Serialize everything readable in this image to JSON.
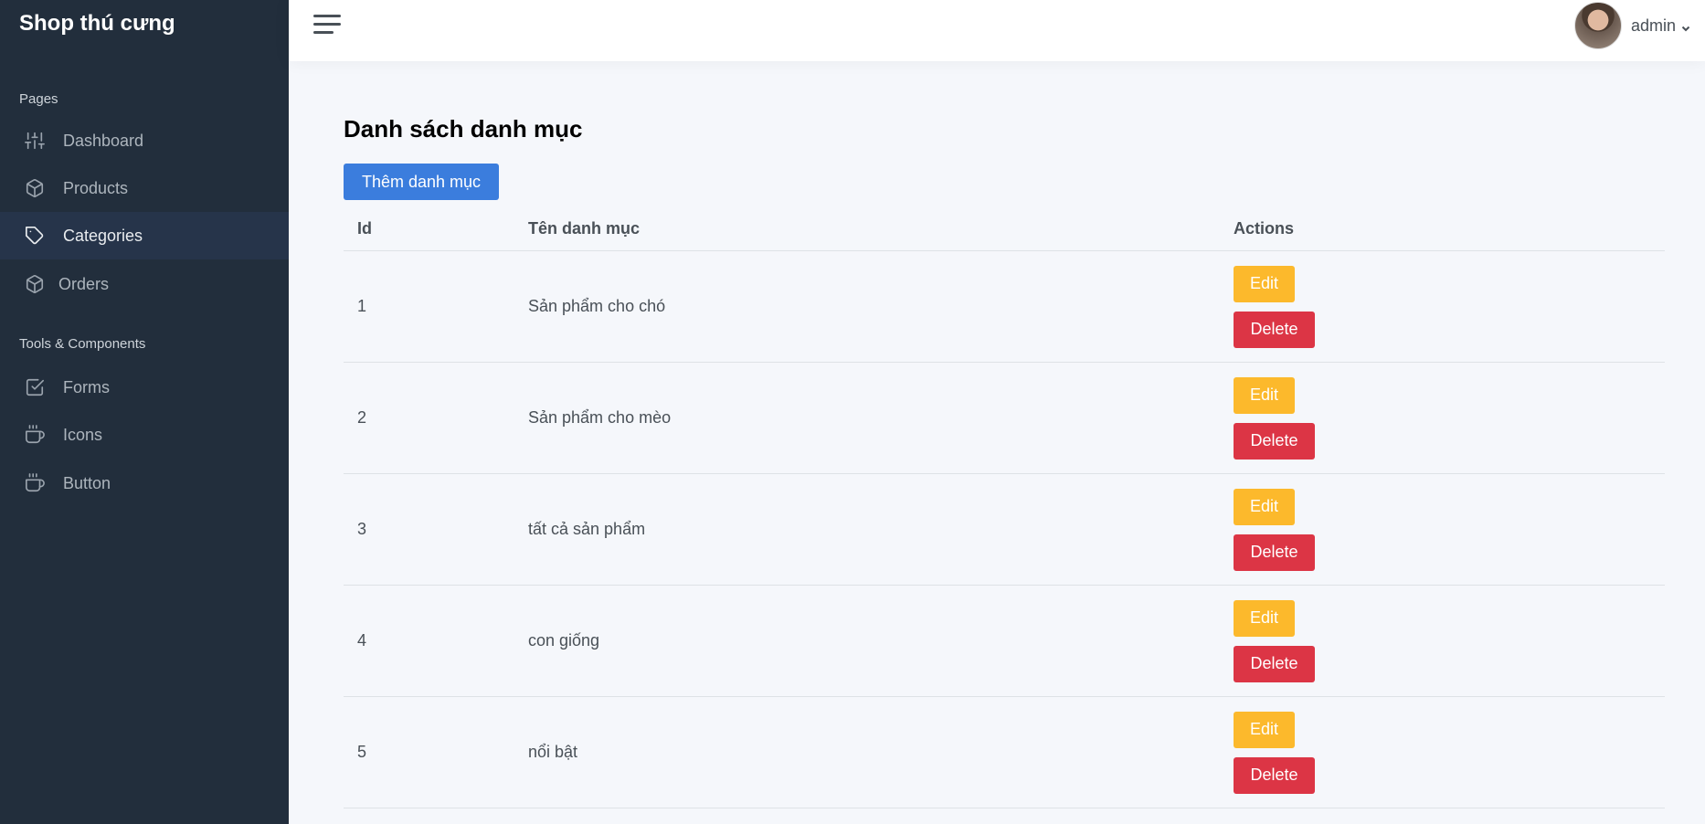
{
  "sidebar": {
    "brand": "Shop thú cưng",
    "sections": [
      {
        "header": "Pages",
        "items": [
          {
            "label": "Dashboard",
            "icon": "sliders-icon",
            "active": false
          },
          {
            "label": "Products",
            "icon": "box-icon",
            "active": false
          },
          {
            "label": "Categories",
            "icon": "tag-icon",
            "active": true
          },
          {
            "label": "Orders",
            "icon": "box-icon",
            "active": false
          }
        ]
      },
      {
        "header": "Tools & Components",
        "items": [
          {
            "label": "Forms",
            "icon": "check-square-icon",
            "active": false
          },
          {
            "label": "Icons",
            "icon": "coffee-icon",
            "active": false
          },
          {
            "label": "Button",
            "icon": "coffee-icon",
            "active": false
          }
        ]
      }
    ]
  },
  "topbar": {
    "menu_icon": "hamburger-icon",
    "user_name": "admin"
  },
  "main": {
    "title": "Danh sách danh mục",
    "add_button": "Thêm danh mục",
    "table": {
      "headers": [
        "Id",
        "Tên danh mục",
        "Actions"
      ],
      "rows": [
        {
          "id": "1",
          "name": "Sản phẩm cho chó"
        },
        {
          "id": "2",
          "name": "Sản phẩm cho mèo"
        },
        {
          "id": "3",
          "name": "tất cả sản phẩm"
        },
        {
          "id": "4",
          "name": "con giống"
        },
        {
          "id": "5",
          "name": "nổi bật"
        }
      ],
      "edit_label": "Edit",
      "delete_label": "Delete"
    }
  },
  "colors": {
    "sidebar_bg": "#222e3c",
    "primary": "#3b7ddd",
    "warning": "#fcb92c",
    "danger": "#dc3545"
  }
}
